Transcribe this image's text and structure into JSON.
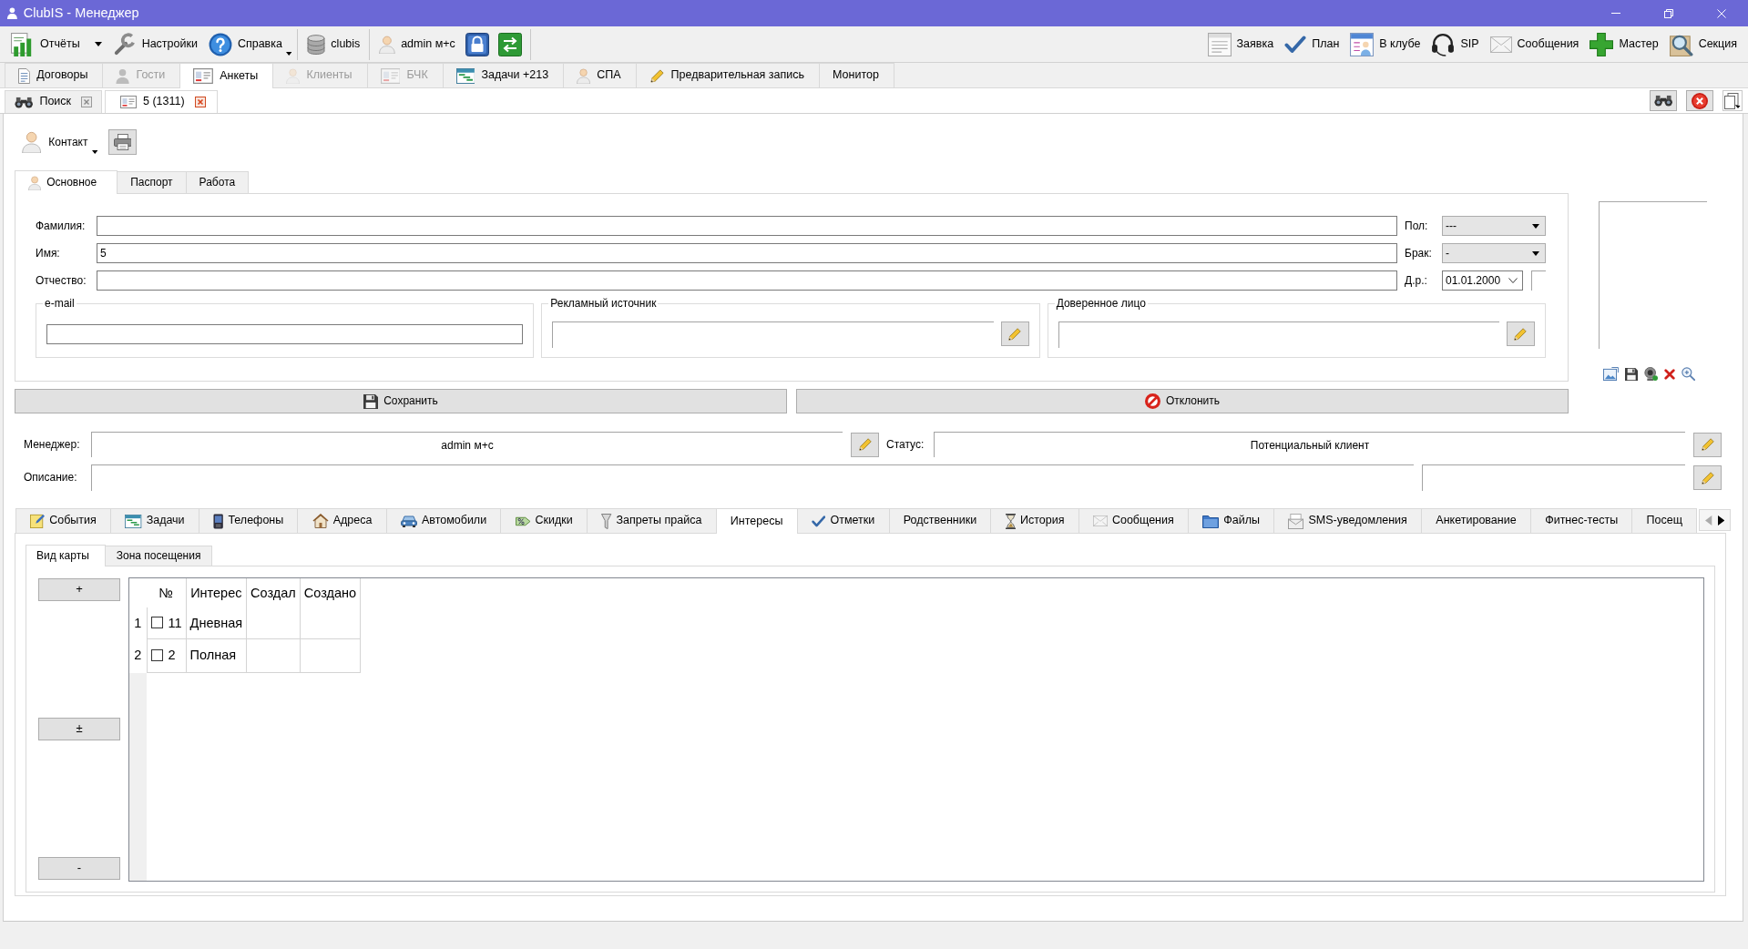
{
  "window": {
    "title": "ClubIS - Менеджер"
  },
  "toolbar": {
    "groups": [
      {
        "items": [
          {
            "label": "Отчёты",
            "kind": "split"
          },
          {
            "label": "Настройки",
            "kind": "plain"
          },
          {
            "label": "Справка",
            "kind": "menu"
          }
        ]
      },
      {
        "items": [
          {
            "label": "clubis",
            "kind": "plain"
          }
        ]
      },
      {
        "items": [
          {
            "label": "admin м+с",
            "kind": "plain"
          }
        ]
      }
    ],
    "right_items": [
      {
        "label": "Заявка"
      },
      {
        "label": "План"
      },
      {
        "label": "В клубе"
      },
      {
        "label": "SIP"
      },
      {
        "label": "Сообщения"
      },
      {
        "label": "Мастер"
      },
      {
        "label": "Секция"
      }
    ]
  },
  "module_tabs": [
    {
      "label": "Договоры",
      "selected": false,
      "disabled": false
    },
    {
      "label": "Гости",
      "selected": false,
      "disabled": true
    },
    {
      "label": "Анкеты",
      "selected": true,
      "disabled": false
    },
    {
      "label": "Клиенты",
      "selected": false,
      "disabled": true
    },
    {
      "label": "БЧК",
      "selected": false,
      "disabled": true
    },
    {
      "label": "Задачи +213",
      "selected": false,
      "disabled": false
    },
    {
      "label": "СПА",
      "selected": false,
      "disabled": false
    },
    {
      "label": "Предварительная запись",
      "selected": false,
      "disabled": false
    },
    {
      "label": "Монитор",
      "selected": false,
      "disabled": false
    }
  ],
  "document_tabs": [
    {
      "label": "Поиск",
      "selected": false
    },
    {
      "label": "5 (1311)",
      "selected": true
    }
  ],
  "contact_menu": {
    "label": "Контакт"
  },
  "form_tabs": [
    {
      "label": "Основное",
      "selected": true
    },
    {
      "label": "Паспорт",
      "selected": false
    },
    {
      "label": "Работа",
      "selected": false
    }
  ],
  "name_fields": [
    {
      "label": "Фамилия:"
    },
    {
      "label": "Имя:",
      "value": "5"
    },
    {
      "label": "Отчество:"
    }
  ],
  "side_fields": [
    {
      "label": "Пол:",
      "kind": "combo",
      "value": "---"
    },
    {
      "label": "Брак:",
      "kind": "combo",
      "value": "-"
    },
    {
      "label": "Д.р.:",
      "kind": "date",
      "value": "01.01.2000"
    }
  ],
  "field_groups": [
    {
      "title": "e-mail",
      "kind": "input"
    },
    {
      "title": "Рекламный источник",
      "kind": "picker"
    },
    {
      "title": "Доверенное лицо",
      "kind": "picker"
    }
  ],
  "actions": [
    {
      "label": "Сохранить"
    },
    {
      "label": "Отклонить"
    }
  ],
  "manager": {
    "label": "Менеджер:",
    "value": "admin м+с"
  },
  "status": {
    "label": "Статус:",
    "value": "Потенциальный клиент"
  },
  "description": {
    "label": "Описание:"
  },
  "detail_tabs": [
    {
      "label": "События",
      "selected": false
    },
    {
      "label": "Задачи",
      "selected": false
    },
    {
      "label": "Телефоны",
      "selected": false
    },
    {
      "label": "Адреса",
      "selected": false
    },
    {
      "label": "Автомобили",
      "selected": false
    },
    {
      "label": "Скидки",
      "selected": false
    },
    {
      "label": "Запреты прайса",
      "selected": false
    },
    {
      "label": "Интересы",
      "selected": true
    },
    {
      "label": "Отметки",
      "selected": false
    },
    {
      "label": "Родственники",
      "selected": false
    },
    {
      "label": "История",
      "selected": false
    },
    {
      "label": "Сообщения",
      "selected": false
    },
    {
      "label": "Файлы",
      "selected": false
    },
    {
      "label": "SMS-уведомления",
      "selected": false
    },
    {
      "label": "Анкетирование",
      "selected": false
    },
    {
      "label": "Фитнес-тесты",
      "selected": false
    },
    {
      "label": "Посещ",
      "selected": false
    }
  ],
  "card_tabs": [
    {
      "label": "Вид карты",
      "selected": true
    },
    {
      "label": "Зона посещения",
      "selected": false
    }
  ],
  "side_buttons": [
    {
      "label": "+"
    },
    {
      "label": "±"
    },
    {
      "label": "-"
    }
  ],
  "table": {
    "columns": [
      "№",
      "Интерес",
      "Создал",
      "Создано"
    ],
    "rows": [
      {
        "row_header": "1",
        "checked": false,
        "number": "11",
        "interest": "Дневная"
      },
      {
        "row_header": "2",
        "checked": false,
        "number": "2",
        "interest": "Полная"
      }
    ]
  }
}
